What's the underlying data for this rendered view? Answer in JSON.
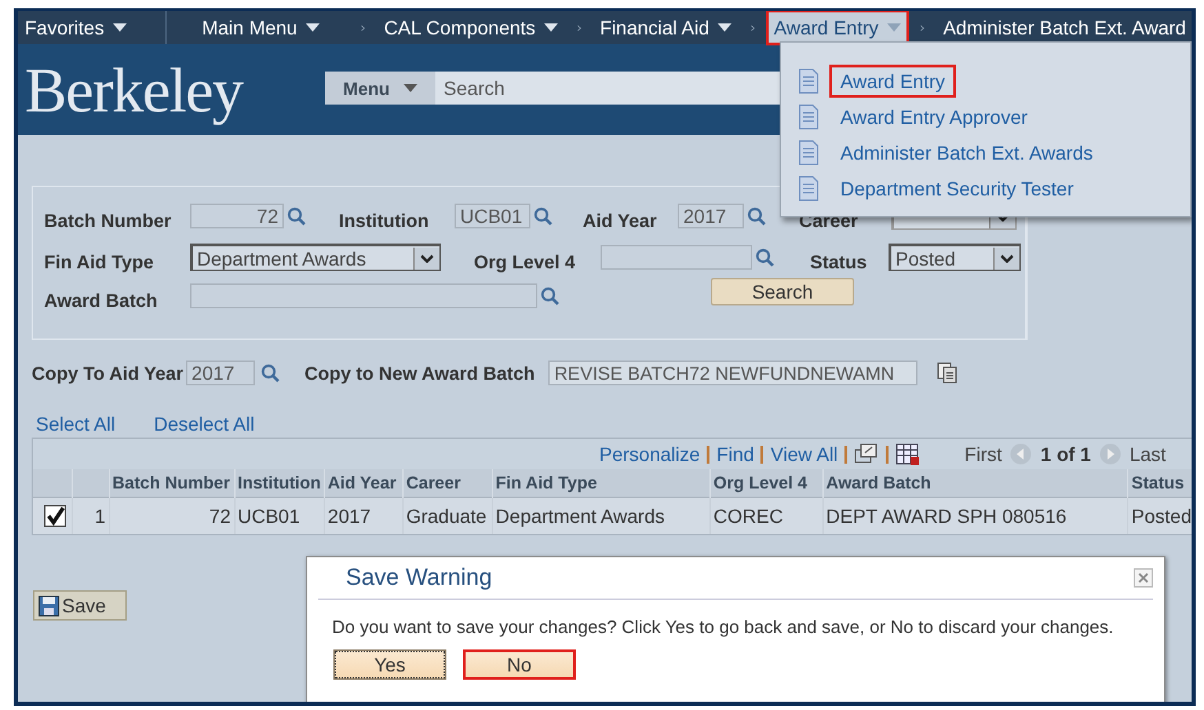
{
  "nav": {
    "items": [
      {
        "label": "Favorites",
        "has_menu": true,
        "highlighted": false,
        "chevron": false
      },
      {
        "label": "Main Menu",
        "has_menu": true,
        "highlighted": false,
        "chevron": false
      },
      {
        "label": "CAL Components",
        "has_menu": true,
        "highlighted": false,
        "chevron": true
      },
      {
        "label": "Financial Aid",
        "has_menu": true,
        "highlighted": false,
        "chevron": true
      },
      {
        "label": "Award Entry",
        "has_menu": true,
        "highlighted": true,
        "chevron": true
      },
      {
        "label": "Administer Batch Ext. Award",
        "has_menu": false,
        "highlighted": false,
        "chevron": true
      }
    ]
  },
  "header": {
    "logo": "Berkeley",
    "menu_button": "Menu",
    "search_placeholder": "Search"
  },
  "dropdown": {
    "items": [
      {
        "label": "Award Entry",
        "highlighted": true
      },
      {
        "label": "Award Entry Approver",
        "highlighted": false
      },
      {
        "label": "Administer Batch Ext. Awards",
        "highlighted": false
      },
      {
        "label": "Department Security Tester",
        "highlighted": false
      }
    ]
  },
  "search_form": {
    "rows": [
      [
        {
          "label": "Batch Number",
          "kind": "lookup",
          "value": "72"
        },
        {
          "label": "Institution",
          "kind": "lookup",
          "value": "UCB01"
        },
        {
          "label": "Aid Year",
          "kind": "lookup",
          "value": "2017"
        },
        {
          "label": "Career",
          "kind": "select",
          "disabled": true
        }
      ],
      [
        {
          "label": "Fin Aid Type",
          "kind": "select",
          "value": "Department Awards",
          "disabled": false
        },
        {
          "label": "Org Level 4",
          "kind": "lookup"
        },
        "",
        {
          "label": "Status",
          "kind": "select",
          "value": "Posted",
          "disabled": false
        }
      ],
      [
        {
          "label": "Award Batch",
          "kind": "lookup"
        }
      ]
    ],
    "search_button": "Search"
  },
  "copy_row": {
    "aid_year_label": "Copy To Aid Year",
    "aid_year_value": "2017",
    "batch_label": "Copy to New Award Batch",
    "batch_value": "REVISE BATCH72 NEWFUNDNEWAMN"
  },
  "select_links": [
    "Select All",
    "Deselect All"
  ],
  "table": {
    "toolbar": {
      "links": [
        "Personalize",
        "Find",
        "View All"
      ],
      "first": "First",
      "page": "1 of 1",
      "last": "Last"
    },
    "columns": [
      "Batch Number",
      "Institution",
      "Aid Year",
      "Career",
      "Fin Aid Type",
      "Org Level 4",
      "Award Batch",
      "Status"
    ],
    "rows": [
      {
        "checked": true,
        "number": "1",
        "cells": [
          "72",
          "UCB01",
          "2017",
          "Graduate",
          "Department Awards",
          "COREC",
          "DEPT AWARD SPH 080516",
          "Posted"
        ]
      }
    ]
  },
  "save_button": "Save",
  "dialog": {
    "title": "Save Warning",
    "message": "Do you want to save your changes? Click Yes to go back and save, or No to discard your changes.",
    "buttons": [
      {
        "label": "Yes",
        "focused": true,
        "highlighted": false
      },
      {
        "label": "No",
        "focused": false,
        "highlighted": true
      }
    ]
  }
}
